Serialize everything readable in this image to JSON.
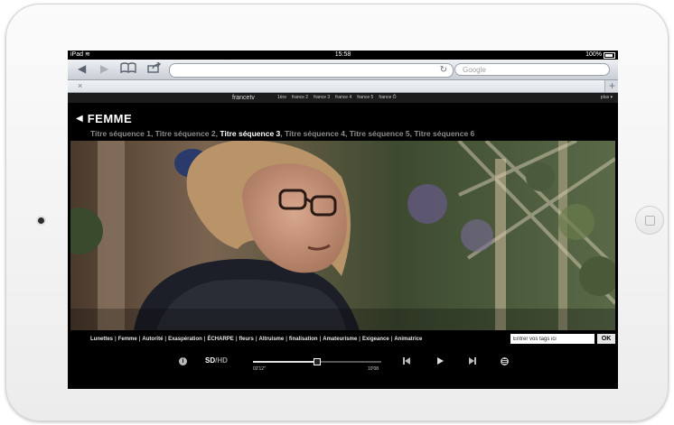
{
  "status_bar": {
    "device": "iPad",
    "time": "15:58",
    "battery": "100%"
  },
  "browser": {
    "search_placeholder": "Google",
    "tab_close": "×",
    "new_tab": "+"
  },
  "ftv_bar": {
    "logo": "francetv",
    "channels": [
      "1ère",
      "france 2",
      "france 3",
      "france 4",
      "france 5",
      "france Ô"
    ],
    "more": "plus ▾"
  },
  "program": {
    "title": "FEMME",
    "sequences": [
      "Titre séquence 1",
      "Titre séquence 2",
      "Titre séquence 3",
      "Titre séquence 4",
      "Titre séquence 5",
      "Titre séquence 6"
    ],
    "active_sequence_index": 2
  },
  "tags": [
    "Lunettes",
    "Femme",
    "Autorité",
    "Exaspération",
    "ÉCHARPE",
    "fleurs",
    "Altruisme",
    "finalisation",
    "Amateurisme",
    "Exigeance",
    "Animatrice"
  ],
  "tag_input": {
    "placeholder": "Entrer vos tags ici",
    "ok_label": "OK"
  },
  "player": {
    "sd_label": "SD",
    "separator": "/",
    "hd_label": "HD",
    "current_time": "02'12''",
    "total_time": "10'08",
    "progress": 0.49
  }
}
